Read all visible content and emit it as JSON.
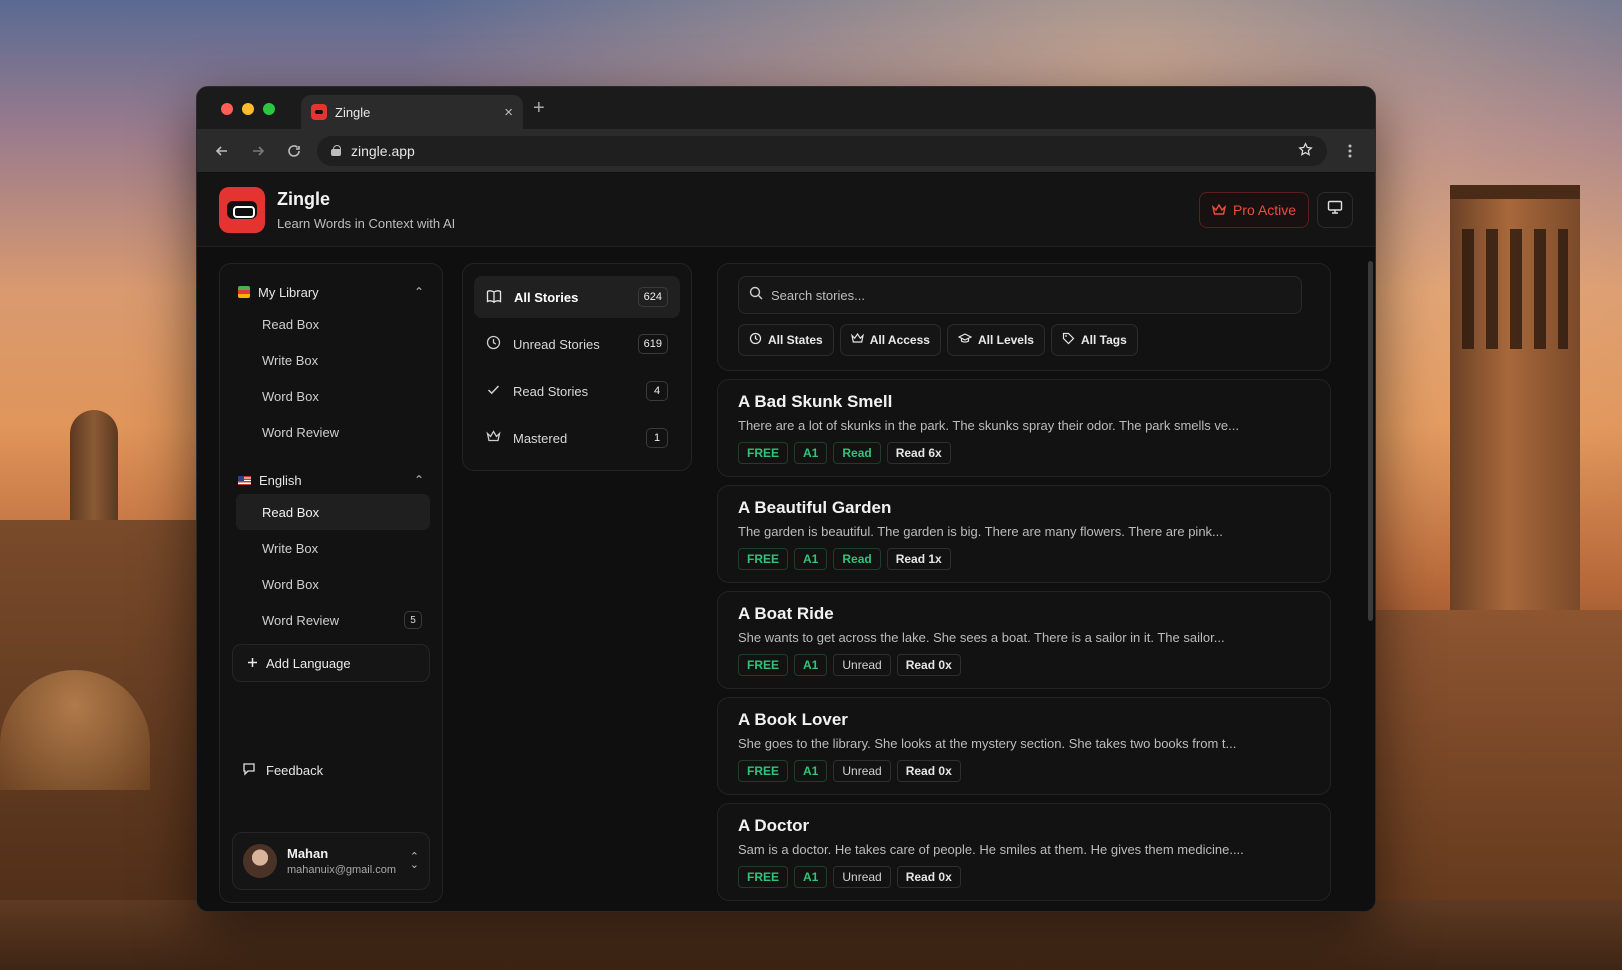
{
  "browser": {
    "tab_title": "Zingle",
    "url": "zingle.app",
    "new_tab": "+",
    "close": "×"
  },
  "header": {
    "brand": "Zingle",
    "tagline": "Learn Words in Context with AI",
    "pro_label": "Pro Active",
    "accent": "#ef4a43"
  },
  "sidebar": {
    "library_title": "My Library",
    "library_items": [
      "Read Box",
      "Write Box",
      "Word Box",
      "Word Review"
    ],
    "language_title": "English",
    "language_items": [
      {
        "label": "Read Box"
      },
      {
        "label": "Write Box"
      },
      {
        "label": "Word Box"
      },
      {
        "label": "Word Review",
        "badge": "5"
      }
    ],
    "add_language": "Add Language",
    "feedback": "Feedback",
    "user": {
      "name": "Mahan",
      "email": "mahanuix@gmail.com"
    }
  },
  "filters": [
    {
      "label": "All Stories",
      "count": "624"
    },
    {
      "label": "Unread Stories",
      "count": "619"
    },
    {
      "label": "Read Stories",
      "count": "4"
    },
    {
      "label": "Mastered",
      "count": "1"
    }
  ],
  "search": {
    "placeholder": "Search stories...",
    "chips": [
      "All States",
      "All Access",
      "All Levels",
      "All Tags"
    ]
  },
  "stories": [
    {
      "title": "A Bad Skunk Smell",
      "excerpt": "There are a lot of skunks in the park. The skunks spray their odor. The park smells ve...",
      "access": "FREE",
      "level": "A1",
      "state": "Read",
      "reads": "Read 6x"
    },
    {
      "title": "A Beautiful Garden",
      "excerpt": "The garden is beautiful. The garden is big. There are many flowers. There are pink...",
      "access": "FREE",
      "level": "A1",
      "state": "Read",
      "reads": "Read 1x"
    },
    {
      "title": "A Boat Ride",
      "excerpt": "She wants to get across the lake. She sees a boat. There is a sailor in it. The sailor...",
      "access": "FREE",
      "level": "A1",
      "state": "Unread",
      "reads": "Read 0x"
    },
    {
      "title": "A Book Lover",
      "excerpt": "She goes to the library. She looks at the mystery section. She takes two books from t...",
      "access": "FREE",
      "level": "A1",
      "state": "Unread",
      "reads": "Read 0x"
    },
    {
      "title": "A Doctor",
      "excerpt": "Sam is a doctor. He takes care of people. He smiles at them. He gives them medicine....",
      "access": "FREE",
      "level": "A1",
      "state": "Unread",
      "reads": "Read 0x"
    }
  ]
}
